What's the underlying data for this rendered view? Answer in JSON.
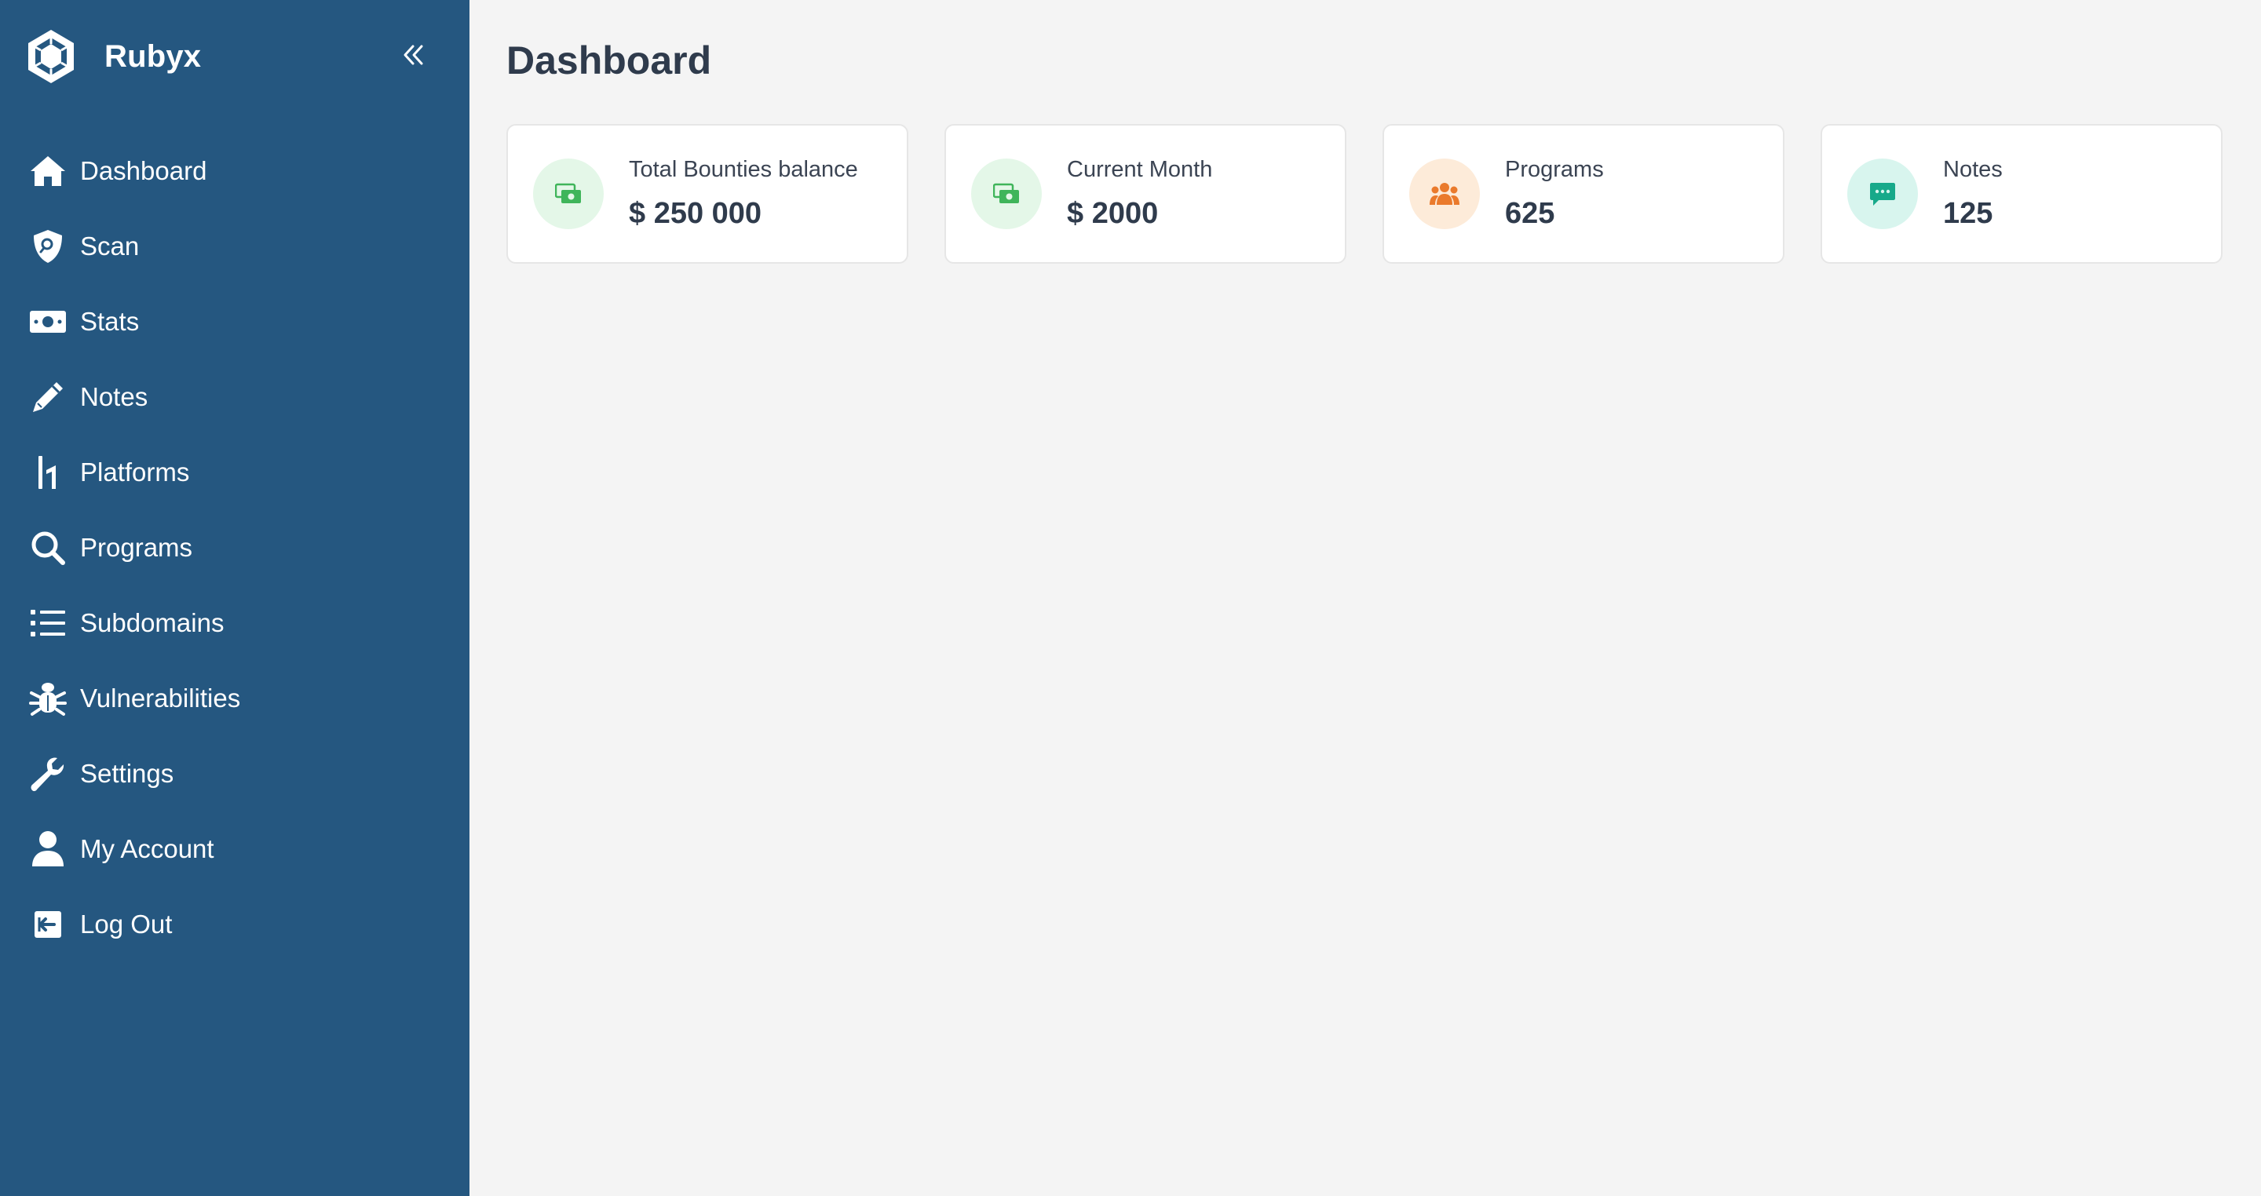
{
  "app": {
    "name": "Rubyx"
  },
  "sidebar": {
    "items": [
      {
        "label": "Dashboard",
        "icon": "home-icon"
      },
      {
        "label": "Scan",
        "icon": "shield-search-icon"
      },
      {
        "label": "Stats",
        "icon": "money-bill-icon"
      },
      {
        "label": "Notes",
        "icon": "pencil-icon"
      },
      {
        "label": "Platforms",
        "icon": "hackerone-icon"
      },
      {
        "label": "Programs",
        "icon": "search-icon"
      },
      {
        "label": "Subdomains",
        "icon": "list-icon"
      },
      {
        "label": "Vulnerabilities",
        "icon": "bug-icon"
      },
      {
        "label": "Settings",
        "icon": "wrench-icon"
      },
      {
        "label": "My Account",
        "icon": "user-icon"
      },
      {
        "label": "Log Out",
        "icon": "logout-icon"
      }
    ]
  },
  "main": {
    "title": "Dashboard",
    "cards": [
      {
        "label": "Total Bounties balance",
        "value": "$ 250 000",
        "icon": "money-icon",
        "icon_color": "#3fb55a",
        "icon_bg": "#e4f7e8"
      },
      {
        "label": "Current Month",
        "value": "$ 2000",
        "icon": "money-icon",
        "icon_color": "#3fb55a",
        "icon_bg": "#e4f7e8"
      },
      {
        "label": "Programs",
        "value": "625",
        "icon": "users-icon",
        "icon_color": "#ea7a2c",
        "icon_bg": "#fdebd9"
      },
      {
        "label": "Notes",
        "value": "125",
        "icon": "chat-icon",
        "icon_color": "#17a98a",
        "icon_bg": "#d8f5ee"
      }
    ]
  },
  "colors": {
    "sidebar_bg": "#255780",
    "page_bg": "#f4f4f4",
    "card_bg": "#ffffff"
  }
}
